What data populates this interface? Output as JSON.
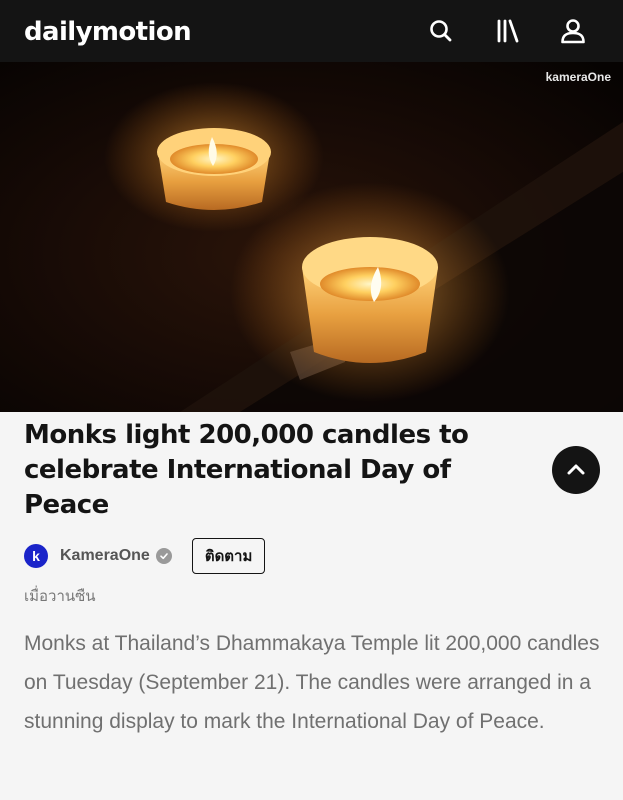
{
  "header": {
    "logo": "dailymotion",
    "icons": [
      "search-icon",
      "library-icon",
      "user-icon"
    ],
    "background": "#141414"
  },
  "video": {
    "watermark": "kameraOne"
  },
  "main": {
    "title": "Monks light 200,000 candles to celebrate International Day of Peace",
    "collapse_icon": "chevron-up-icon"
  },
  "channel": {
    "avatar_letter": "k",
    "avatar_color": "#1a24c9",
    "name": "KameraOne",
    "verified_icon": "verified-check-icon",
    "follow_label": "ติดตาม"
  },
  "meta": {
    "timestamp": "เมื่อวานซืน"
  },
  "description": "Monks at Thailand’s Dhammakaya Temple lit 200,000 candles on Tuesday (September 21). The candles were arranged in a stunning display to mark the International Day of Peace."
}
